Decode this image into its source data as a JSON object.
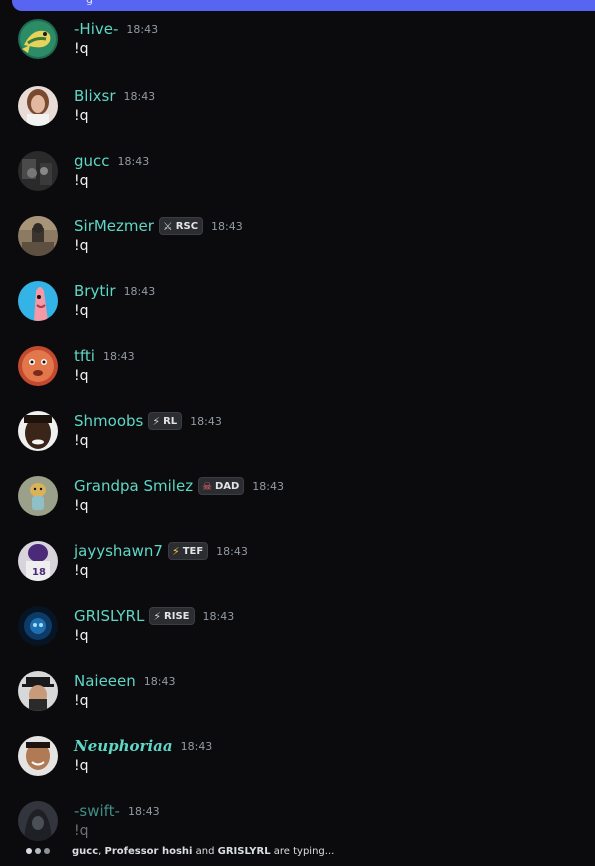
{
  "top_banner": {
    "fragment": "g"
  },
  "messages": [
    {
      "username": "-Hive-",
      "tag": null,
      "time": "18:43",
      "text": "!q",
      "avatar": "dragon-avatar"
    },
    {
      "username": "Blixsr",
      "tag": null,
      "time": "18:43",
      "text": "!q",
      "avatar": "woman-avatar"
    },
    {
      "username": "gucc",
      "tag": null,
      "time": "18:43",
      "text": "!q",
      "avatar": "dark-photo-avatar"
    },
    {
      "username": "SirMezmer",
      "tag": {
        "icon": "sword-icon",
        "label": "RSC"
      },
      "time": "18:43",
      "text": "!q",
      "avatar": "room-avatar"
    },
    {
      "username": "Brytir",
      "tag": null,
      "time": "18:43",
      "text": "!q",
      "avatar": "patrick-avatar"
    },
    {
      "username": "tfti",
      "tag": null,
      "time": "18:43",
      "text": "!q",
      "avatar": "face-avatar"
    },
    {
      "username": "Shmoobs",
      "tag": {
        "icon": "bolt-icon",
        "label": "RL"
      },
      "time": "18:43",
      "text": "!q",
      "avatar": "man-face-avatar"
    },
    {
      "username": "Grandpa Smilez",
      "tag": {
        "icon": "skull-icon",
        "label": "DAD"
      },
      "time": "18:43",
      "text": "!q",
      "avatar": "dog-avatar"
    },
    {
      "username": "jayyshawn7",
      "tag": {
        "icon": "bolt-icon",
        "label": "TEF"
      },
      "time": "18:43",
      "text": "!q",
      "avatar": "football-avatar"
    },
    {
      "username": "GRISLYRL",
      "tag": {
        "icon": "bolt-icon",
        "label": "RISE"
      },
      "time": "18:43",
      "text": "!q",
      "avatar": "blue-glow-avatar"
    },
    {
      "username": "Naieeen",
      "tag": null,
      "time": "18:43",
      "text": "!q",
      "avatar": "hat-man-avatar"
    },
    {
      "username": "Neuphoriaa",
      "tag": null,
      "time": "18:43",
      "text": "!q",
      "avatar": "smiling-man-avatar"
    },
    {
      "username": "-swift-",
      "tag": null,
      "time": "18:43",
      "text": "!q",
      "avatar": "hooded-avatar"
    }
  ],
  "typing": {
    "user1": "gucc",
    "sep1": ", ",
    "user2": "Professor hoshi",
    "sep2": " and ",
    "user3": "GRISLYRL",
    "suffix": " are typing..."
  },
  "colors": {
    "background": "#0b0b0d",
    "username": "#5fd7c7",
    "accent_bar": "#5865f2",
    "timestamp": "#949ba4"
  }
}
